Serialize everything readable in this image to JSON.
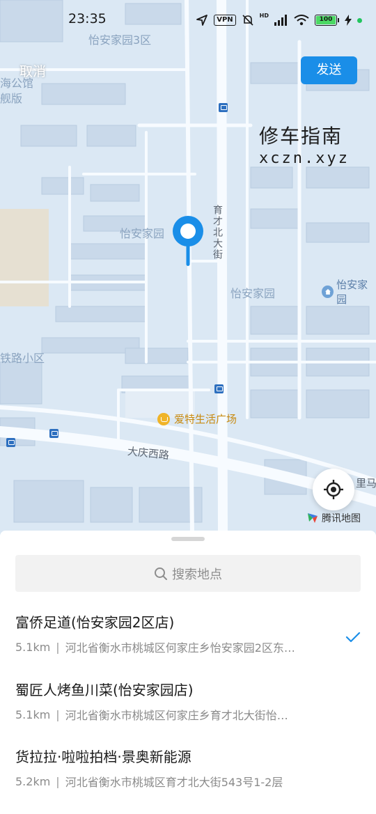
{
  "status_bar": {
    "time": "23:35",
    "vpn": "VPN",
    "signal_tag": "HD",
    "battery": "100"
  },
  "header": {
    "cancel_label": "取消",
    "send_label": "发送"
  },
  "watermark": {
    "title": "修车指南",
    "url": "xczn.xyz"
  },
  "map": {
    "labels": {
      "north_block": "怡安家园3区",
      "west_edge_1": "海公馆",
      "west_edge_2": "舰版",
      "center_block": "怡安家园",
      "road_vertical": "育才北大街",
      "east_block": "怡安家园",
      "home_poi": "怡安家园",
      "rail_district": "铁路小区",
      "mall": "爱特生活广场",
      "road_horizontal": "大庆西路",
      "edge_right": "里马"
    },
    "brand_label": "腾讯地图"
  },
  "search": {
    "placeholder": "搜索地点"
  },
  "results": [
    {
      "name": "富侨足道(怡安家园2区店)",
      "distance": "5.1km",
      "address": "河北省衡水市桃城区何家庄乡怡安家园2区东…",
      "selected": true
    },
    {
      "name": "蜀匠人烤鱼川菜(怡安家园店)",
      "distance": "5.1km",
      "address": "河北省衡水市桃城区何家庄乡育才北大街怡…",
      "selected": false
    },
    {
      "name": "货拉拉·啦啦拍档·景奥新能源",
      "distance": "5.2km",
      "address": "河北省衡水市桃城区育才北大街543号1-2层",
      "selected": false
    }
  ],
  "colors": {
    "accent": "#1a8ee8",
    "pin": "#1a8ee8",
    "map_water_blue": "#dce9f5",
    "battery": "#4cd964"
  }
}
